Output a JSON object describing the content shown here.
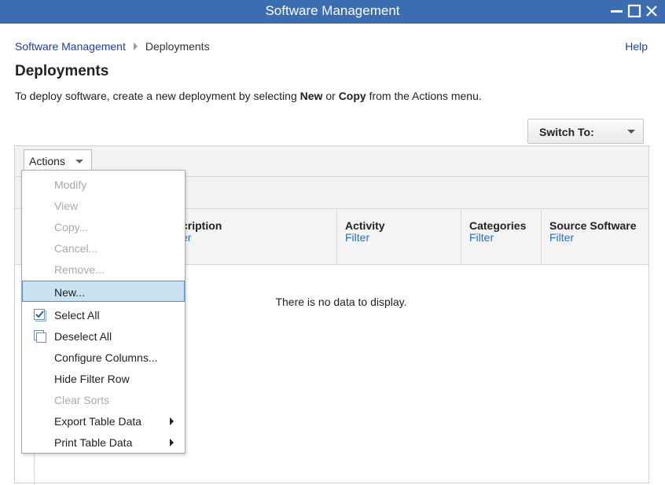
{
  "window": {
    "title": "Software Management"
  },
  "breadcrumb": {
    "root": "Software Management",
    "current": "Deployments"
  },
  "help_label": "Help",
  "page_title": "Deployments",
  "intro": {
    "pre": "To deploy software, create a new deployment by selecting ",
    "new": "New",
    "mid": " or ",
    "copy": "Copy",
    "post": " from the Actions menu."
  },
  "switch_to": {
    "label": "Switch To:"
  },
  "actions": {
    "label": "Actions"
  },
  "columns": [
    {
      "name": "cription",
      "filter": "er"
    },
    {
      "name": "Activity",
      "filter": "Filter"
    },
    {
      "name": "Categories",
      "filter": "Filter"
    },
    {
      "name": "Source Software",
      "filter": "Filter"
    }
  ],
  "empty_message": "There is no data to display.",
  "menu": {
    "items": [
      {
        "label": "Modify",
        "enabled": false
      },
      {
        "label": "View",
        "enabled": false
      },
      {
        "label": "Copy...",
        "enabled": false
      },
      {
        "label": "Cancel...",
        "enabled": false
      },
      {
        "label": "Remove...",
        "enabled": false
      },
      {
        "label": "New...",
        "enabled": true,
        "highlighted": true
      },
      {
        "label": "Select All",
        "enabled": true,
        "icon": "select-all-icon"
      },
      {
        "label": "Deselect All",
        "enabled": true,
        "icon": "deselect-all-icon"
      },
      {
        "label": "Configure Columns...",
        "enabled": true
      },
      {
        "label": "Hide Filter Row",
        "enabled": true
      },
      {
        "label": "Clear Sorts",
        "enabled": false
      },
      {
        "label": "Export Table Data",
        "enabled": true,
        "submenu": true
      },
      {
        "label": "Print Table Data",
        "enabled": true,
        "submenu": true
      }
    ]
  },
  "colors": {
    "titlebar": "#3b6db0",
    "link": "#1d3ea6",
    "filter_link": "#2a6fb5",
    "highlight": "#c9e2f3"
  }
}
